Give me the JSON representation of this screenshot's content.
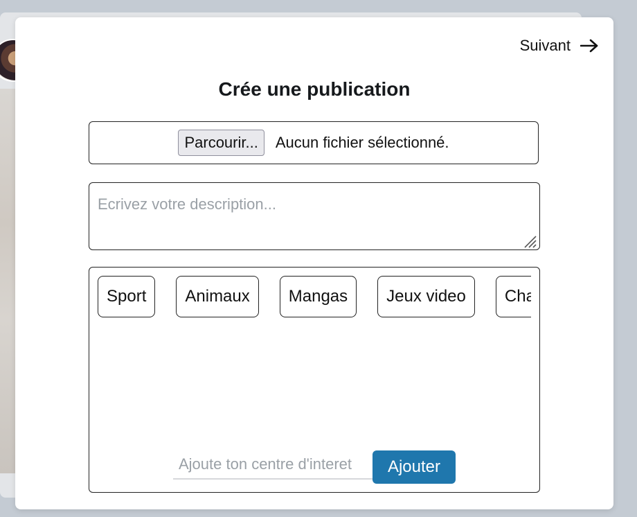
{
  "header": {
    "next_label": "Suivant",
    "next_icon": "arrow-right-icon"
  },
  "modal": {
    "title": "Crée une publication"
  },
  "file_upload": {
    "browse_label": "Parcourir...",
    "status_text": "Aucun fichier sélectionné."
  },
  "description": {
    "placeholder": "Ecrivez votre description...",
    "value": ""
  },
  "interests": {
    "chips": [
      "Sport",
      "Animaux",
      "Mangas",
      "Jeux video",
      "Cha"
    ],
    "input_placeholder": "Ajoute ton centre d'interet",
    "add_label": "Ajouter"
  },
  "colors": {
    "accent": "#1f77ad",
    "border": "#222222",
    "placeholder": "#9aa0a6",
    "backdrop": "#c4cbd3"
  }
}
